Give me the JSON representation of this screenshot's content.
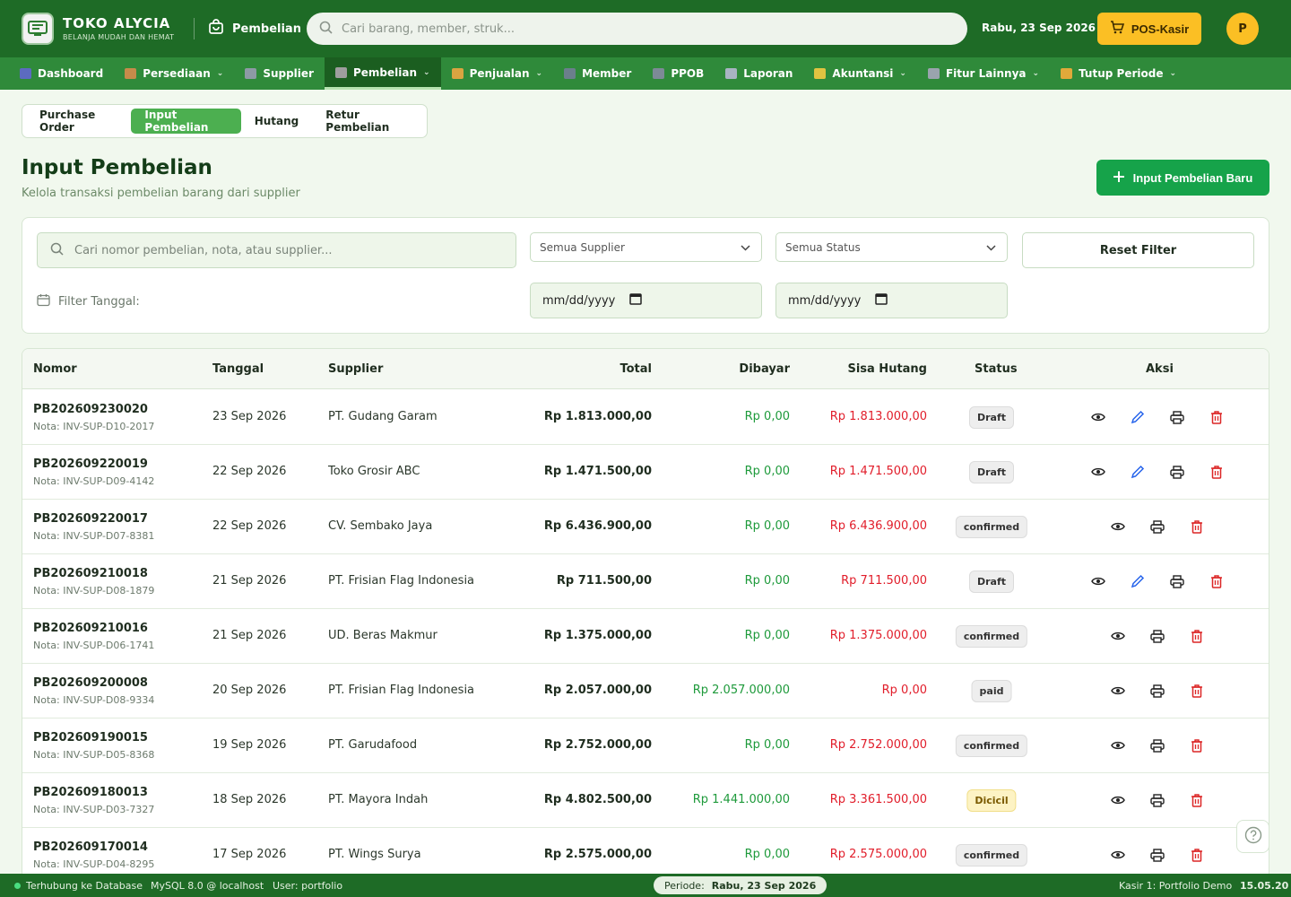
{
  "app": {
    "name": "TOKO ALYCIA",
    "tagline": "BELANJA MUDAH DAN HEMAT",
    "module": "Pembelian",
    "search_placeholder": "Cari barang, member, struk...",
    "date": "Rabu, 23 Sep 2026",
    "pos_button": "POS-Kasir",
    "avatar_initial": "P"
  },
  "nav": [
    {
      "label": "Dashboard",
      "icon": "chart-icon",
      "color": "#5c6bc0",
      "dropdown": false
    },
    {
      "label": "Persediaan",
      "icon": "box-icon",
      "color": "#c58b4a",
      "dropdown": true
    },
    {
      "label": "Supplier",
      "icon": "factory-icon",
      "color": "#8d9aa5",
      "dropdown": false
    },
    {
      "label": "Pembelian",
      "icon": "receipt-icon",
      "color": "#9e9e9e",
      "dropdown": true,
      "active": true
    },
    {
      "label": "Penjualan",
      "icon": "money-bag-icon",
      "color": "#d9a441",
      "dropdown": true
    },
    {
      "label": "Member",
      "icon": "users-icon",
      "color": "#6b7f8c",
      "dropdown": false
    },
    {
      "label": "PPOB",
      "icon": "server-icon",
      "color": "#7d8a96",
      "dropdown": false
    },
    {
      "label": "Laporan",
      "icon": "report-icon",
      "color": "#a8b4c2",
      "dropdown": false
    },
    {
      "label": "Akuntansi",
      "icon": "ledger-icon",
      "color": "#e0c341",
      "dropdown": true
    },
    {
      "label": "Fitur Lainnya",
      "icon": "gear-icon",
      "color": "#9aa4ae",
      "dropdown": true
    },
    {
      "label": "Tutup Periode",
      "icon": "lock-icon",
      "color": "#e0a93a",
      "dropdown": true
    }
  ],
  "subtabs": [
    "Purchase Order",
    "Input Pembelian",
    "Hutang",
    "Retur Pembelian"
  ],
  "page": {
    "title": "Input Pembelian",
    "subtitle": "Kelola transaksi pembelian barang dari supplier",
    "new_button": "Input Pembelian Baru"
  },
  "filter": {
    "search_placeholder": "Cari nomor pembelian, nota, atau supplier...",
    "supplier": "Semua Supplier",
    "status": "Semua Status",
    "reset": "Reset Filter",
    "date_label": "Filter Tanggal:",
    "date_from": "mm/dd/yyyy",
    "date_to": "mm/dd/yyyy"
  },
  "table": {
    "headers": {
      "nomor": "Nomor",
      "tanggal": "Tanggal",
      "supplier": "Supplier",
      "total": "Total",
      "dibayar": "Dibayar",
      "sisa": "Sisa Hutang",
      "status": "Status",
      "aksi": "Aksi"
    },
    "rows": [
      {
        "nomor": "PB202609230020",
        "nota": "Nota: INV-SUP-D10-2017",
        "tanggal": "23 Sep 2026",
        "supplier": "PT. Gudang Garam",
        "total": "Rp 1.813.000,00",
        "dibayar": "Rp 0,00",
        "sisa": "Rp 1.813.000,00",
        "status": "Draft",
        "editable": true
      },
      {
        "nomor": "PB202609220019",
        "nota": "Nota: INV-SUP-D09-4142",
        "tanggal": "22 Sep 2026",
        "supplier": "Toko Grosir ABC",
        "total": "Rp 1.471.500,00",
        "dibayar": "Rp 0,00",
        "sisa": "Rp 1.471.500,00",
        "status": "Draft",
        "editable": true
      },
      {
        "nomor": "PB202609220017",
        "nota": "Nota: INV-SUP-D07-8381",
        "tanggal": "22 Sep 2026",
        "supplier": "CV. Sembako Jaya",
        "total": "Rp 6.436.900,00",
        "dibayar": "Rp 0,00",
        "sisa": "Rp 6.436.900,00",
        "status": "confirmed",
        "editable": false
      },
      {
        "nomor": "PB202609210018",
        "nota": "Nota: INV-SUP-D08-1879",
        "tanggal": "21 Sep 2026",
        "supplier": "PT. Frisian Flag Indonesia",
        "total": "Rp 711.500,00",
        "dibayar": "Rp 0,00",
        "sisa": "Rp 711.500,00",
        "status": "Draft",
        "editable": true
      },
      {
        "nomor": "PB202609210016",
        "nota": "Nota: INV-SUP-D06-1741",
        "tanggal": "21 Sep 2026",
        "supplier": "UD. Beras Makmur",
        "total": "Rp 1.375.000,00",
        "dibayar": "Rp 0,00",
        "sisa": "Rp 1.375.000,00",
        "status": "confirmed",
        "editable": false
      },
      {
        "nomor": "PB202609200008",
        "nota": "Nota: INV-SUP-D08-9334",
        "tanggal": "20 Sep 2026",
        "supplier": "PT. Frisian Flag Indonesia",
        "total": "Rp 2.057.000,00",
        "dibayar": "Rp 2.057.000,00",
        "sisa": "Rp 0,00",
        "status": "paid",
        "editable": false
      },
      {
        "nomor": "PB202609190015",
        "nota": "Nota: INV-SUP-D05-8368",
        "tanggal": "19 Sep 2026",
        "supplier": "PT. Garudafood",
        "total": "Rp 2.752.000,00",
        "dibayar": "Rp 0,00",
        "sisa": "Rp 2.752.000,00",
        "status": "confirmed",
        "editable": false
      },
      {
        "nomor": "PB202609180013",
        "nota": "Nota: INV-SUP-D03-7327",
        "tanggal": "18 Sep 2026",
        "supplier": "PT. Mayora Indah",
        "total": "Rp 4.802.500,00",
        "dibayar": "Rp 1.441.000,00",
        "sisa": "Rp 3.361.500,00",
        "status": "Dicicil",
        "editable": false
      },
      {
        "nomor": "PB202609170014",
        "nota": "Nota: INV-SUP-D04-8295",
        "tanggal": "17 Sep 2026",
        "supplier": "PT. Wings Surya",
        "total": "Rp 2.575.000,00",
        "dibayar": "Rp 0,00",
        "sisa": "Rp 2.575.000,00",
        "status": "confirmed",
        "editable": false
      }
    ]
  },
  "footer": {
    "db_status": "Terhubung ke Database",
    "db_host": "MySQL 8.0 @ localhost",
    "user": "User: portfolio",
    "periode_label": "Periode:",
    "periode_value": "Rabu, 23 Sep 2026",
    "kasir": "Kasir 1: Portfolio Demo",
    "time": "15.05.20"
  }
}
